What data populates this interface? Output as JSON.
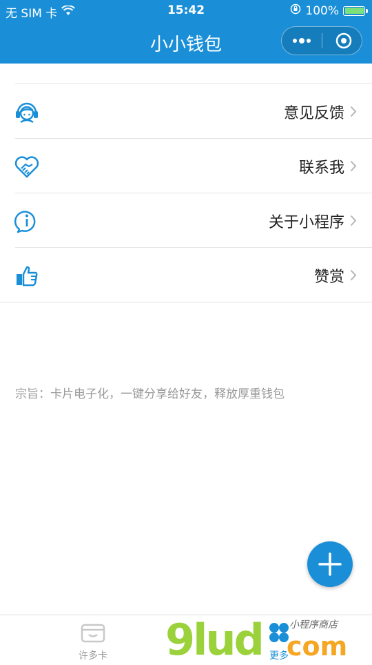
{
  "status_bar": {
    "carrier": "无 SIM 卡",
    "time": "15:42",
    "battery": "100%",
    "battery_fill": 1.0,
    "battery_color": "#7ee07a"
  },
  "nav": {
    "title": "小小钱包",
    "color": "#1a8fd8"
  },
  "menu": [
    {
      "label": "意见反馈",
      "icon": "customer-service-icon"
    },
    {
      "label": "联系我",
      "icon": "handshake-heart-icon"
    },
    {
      "label": "关于小程序",
      "icon": "info-icon"
    },
    {
      "label": "赞赏",
      "icon": "thumbs-up-icon"
    }
  ],
  "motto": "宗旨：卡片电子化，一键分享给好友，释放厚重钱包",
  "fab": {
    "icon": "plus-icon"
  },
  "tabs": [
    {
      "label": "许多卡",
      "icon": "wallet-icon",
      "active": false
    },
    {
      "label": "更多",
      "icon": "grid-icon",
      "active": true
    }
  ],
  "watermark": {
    "text": "9lud",
    "domain": "com",
    "tagline": "小程序商店"
  }
}
